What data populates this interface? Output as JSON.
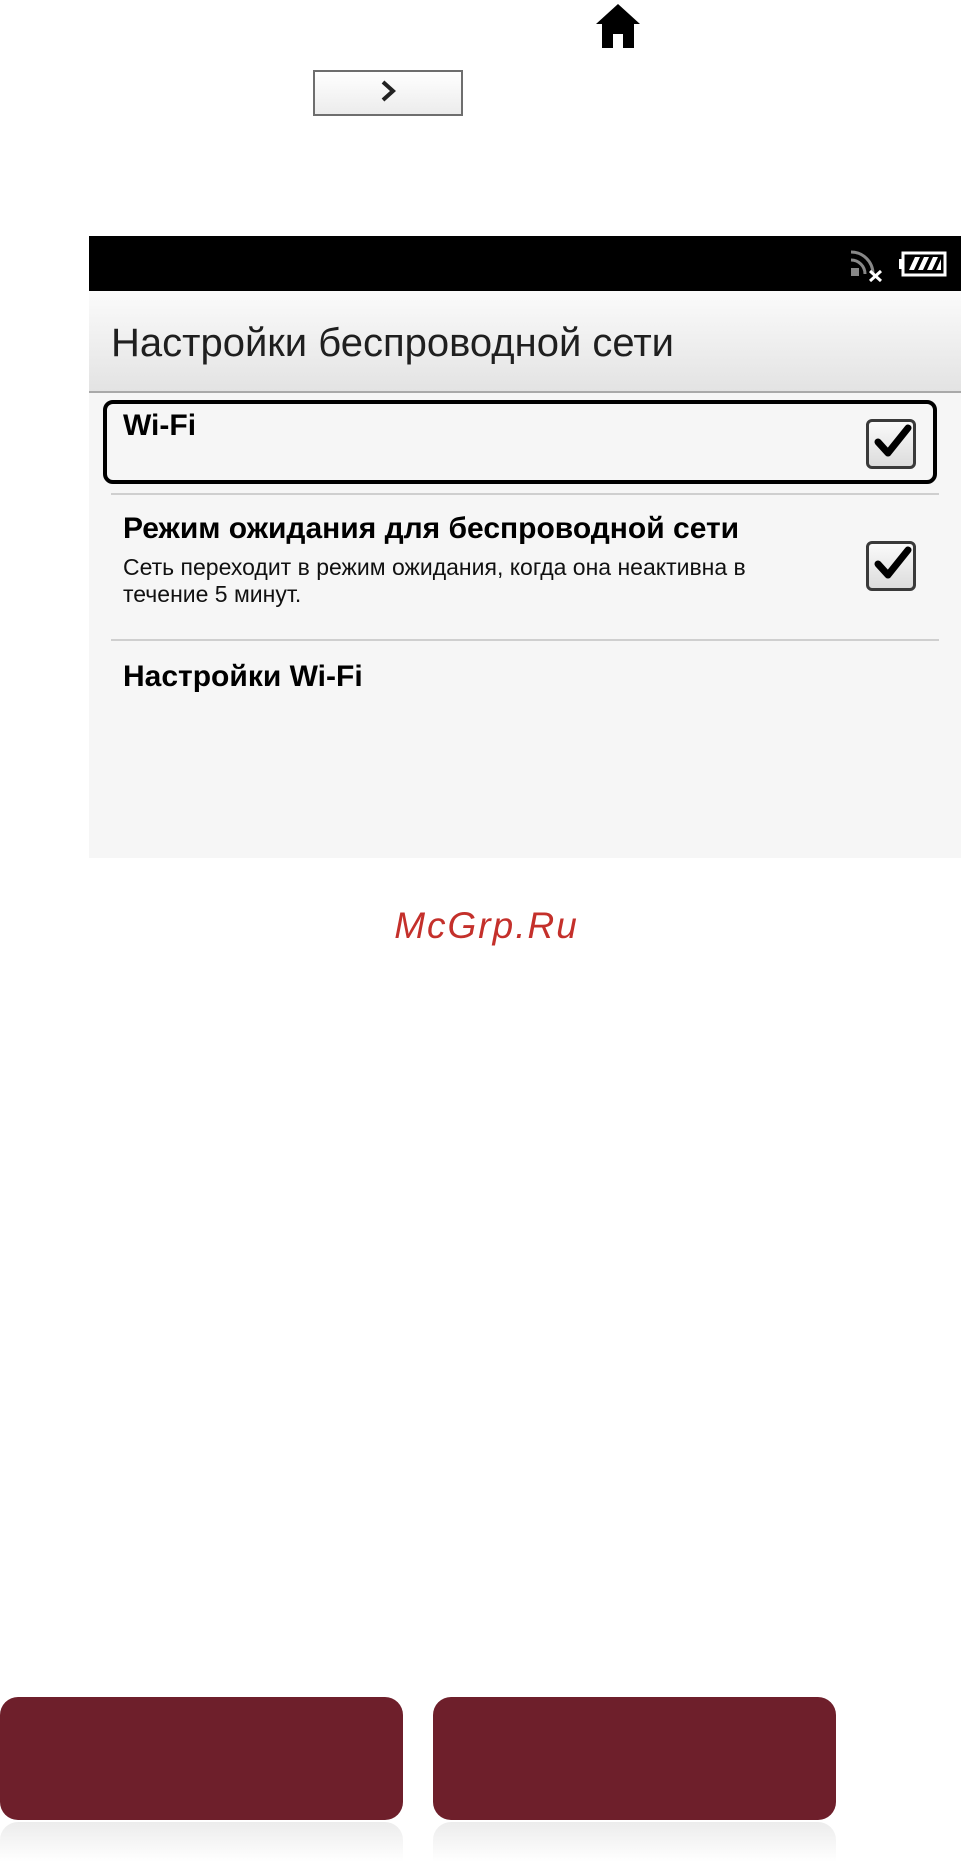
{
  "instructions": {
    "home_icon": "home-icon",
    "next_icon": "chevron-right-icon"
  },
  "device": {
    "status_bar": {
      "icons": [
        "wifi-disconnected-icon",
        "battery-icon"
      ]
    },
    "title": "Настройки беспроводной сети",
    "items": [
      {
        "title": "Wi-Fi",
        "subtitle": "",
        "checked": true,
        "highlighted": true
      },
      {
        "title": "Режим ожидания для беспроводной сети",
        "subtitle": "Сеть переходит в режим ожидания, когда она неактивна в течение 5 минут.",
        "checked": true,
        "highlighted": false
      },
      {
        "title": "Настройки Wi-Fi",
        "subtitle": "",
        "checked": null,
        "highlighted": false
      }
    ]
  },
  "watermark": "McGrp.Ru",
  "bottom_nav": {
    "left_label": "",
    "right_label": ""
  },
  "colors": {
    "accent": "#6e1f2b",
    "watermark": "#c4302b",
    "status_bar": "#000000"
  }
}
